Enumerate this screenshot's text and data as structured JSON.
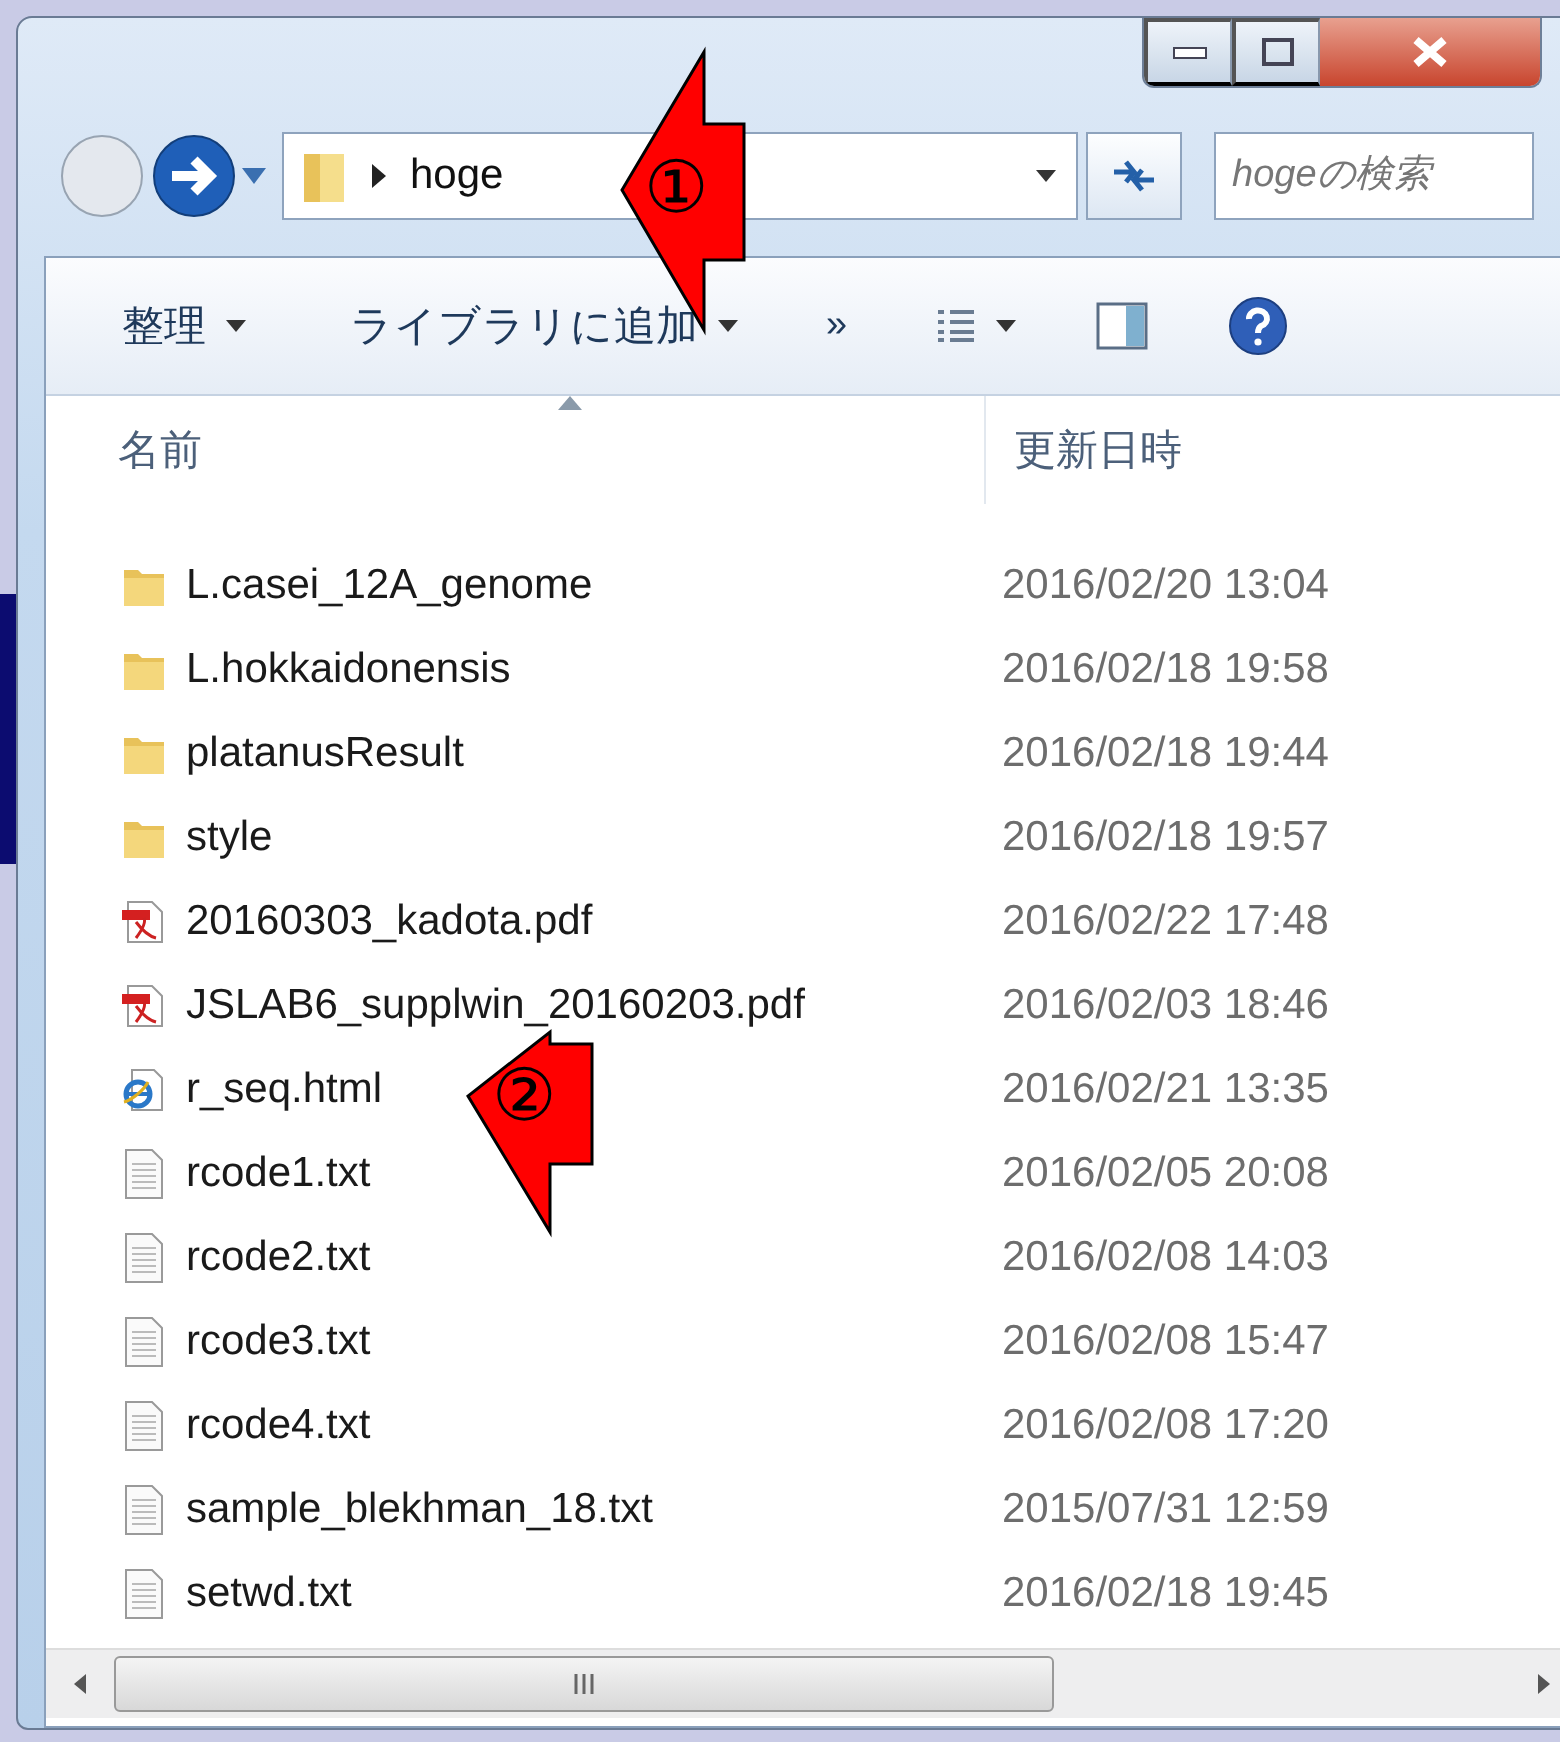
{
  "address_bar": {
    "path": "hoge"
  },
  "search": {
    "placeholder": "hogeの検索"
  },
  "toolbar": {
    "organize": "整理",
    "add_to_library": "ライブラリに追加",
    "more": "»"
  },
  "columns": [
    "名前",
    "更新日時"
  ],
  "files": [
    {
      "name": "L.casei_12A_genome",
      "modified": "2016/02/20 13:04",
      "kind": "folder"
    },
    {
      "name": "L.hokkaidonensis",
      "modified": "2016/02/18 19:58",
      "kind": "folder"
    },
    {
      "name": "platanusResult",
      "modified": "2016/02/18 19:44",
      "kind": "folder"
    },
    {
      "name": "style",
      "modified": "2016/02/18 19:57",
      "kind": "folder"
    },
    {
      "name": "20160303_kadota.pdf",
      "modified": "2016/02/22 17:48",
      "kind": "pdf"
    },
    {
      "name": "JSLAB6_supplwin_20160203.pdf",
      "modified": "2016/02/03 18:46",
      "kind": "pdf"
    },
    {
      "name": "r_seq.html",
      "modified": "2016/02/21 13:35",
      "kind": "html"
    },
    {
      "name": "rcode1.txt",
      "modified": "2016/02/05 20:08",
      "kind": "text"
    },
    {
      "name": "rcode2.txt",
      "modified": "2016/02/08 14:03",
      "kind": "text"
    },
    {
      "name": "rcode3.txt",
      "modified": "2016/02/08 15:47",
      "kind": "text"
    },
    {
      "name": "rcode4.txt",
      "modified": "2016/02/08 17:20",
      "kind": "text"
    },
    {
      "name": "sample_blekhman_18.txt",
      "modified": "2015/07/31 12:59",
      "kind": "text"
    },
    {
      "name": "setwd.txt",
      "modified": "2016/02/18 19:45",
      "kind": "text"
    }
  ],
  "annotations": [
    {
      "number": "①"
    },
    {
      "number": "②"
    }
  ]
}
